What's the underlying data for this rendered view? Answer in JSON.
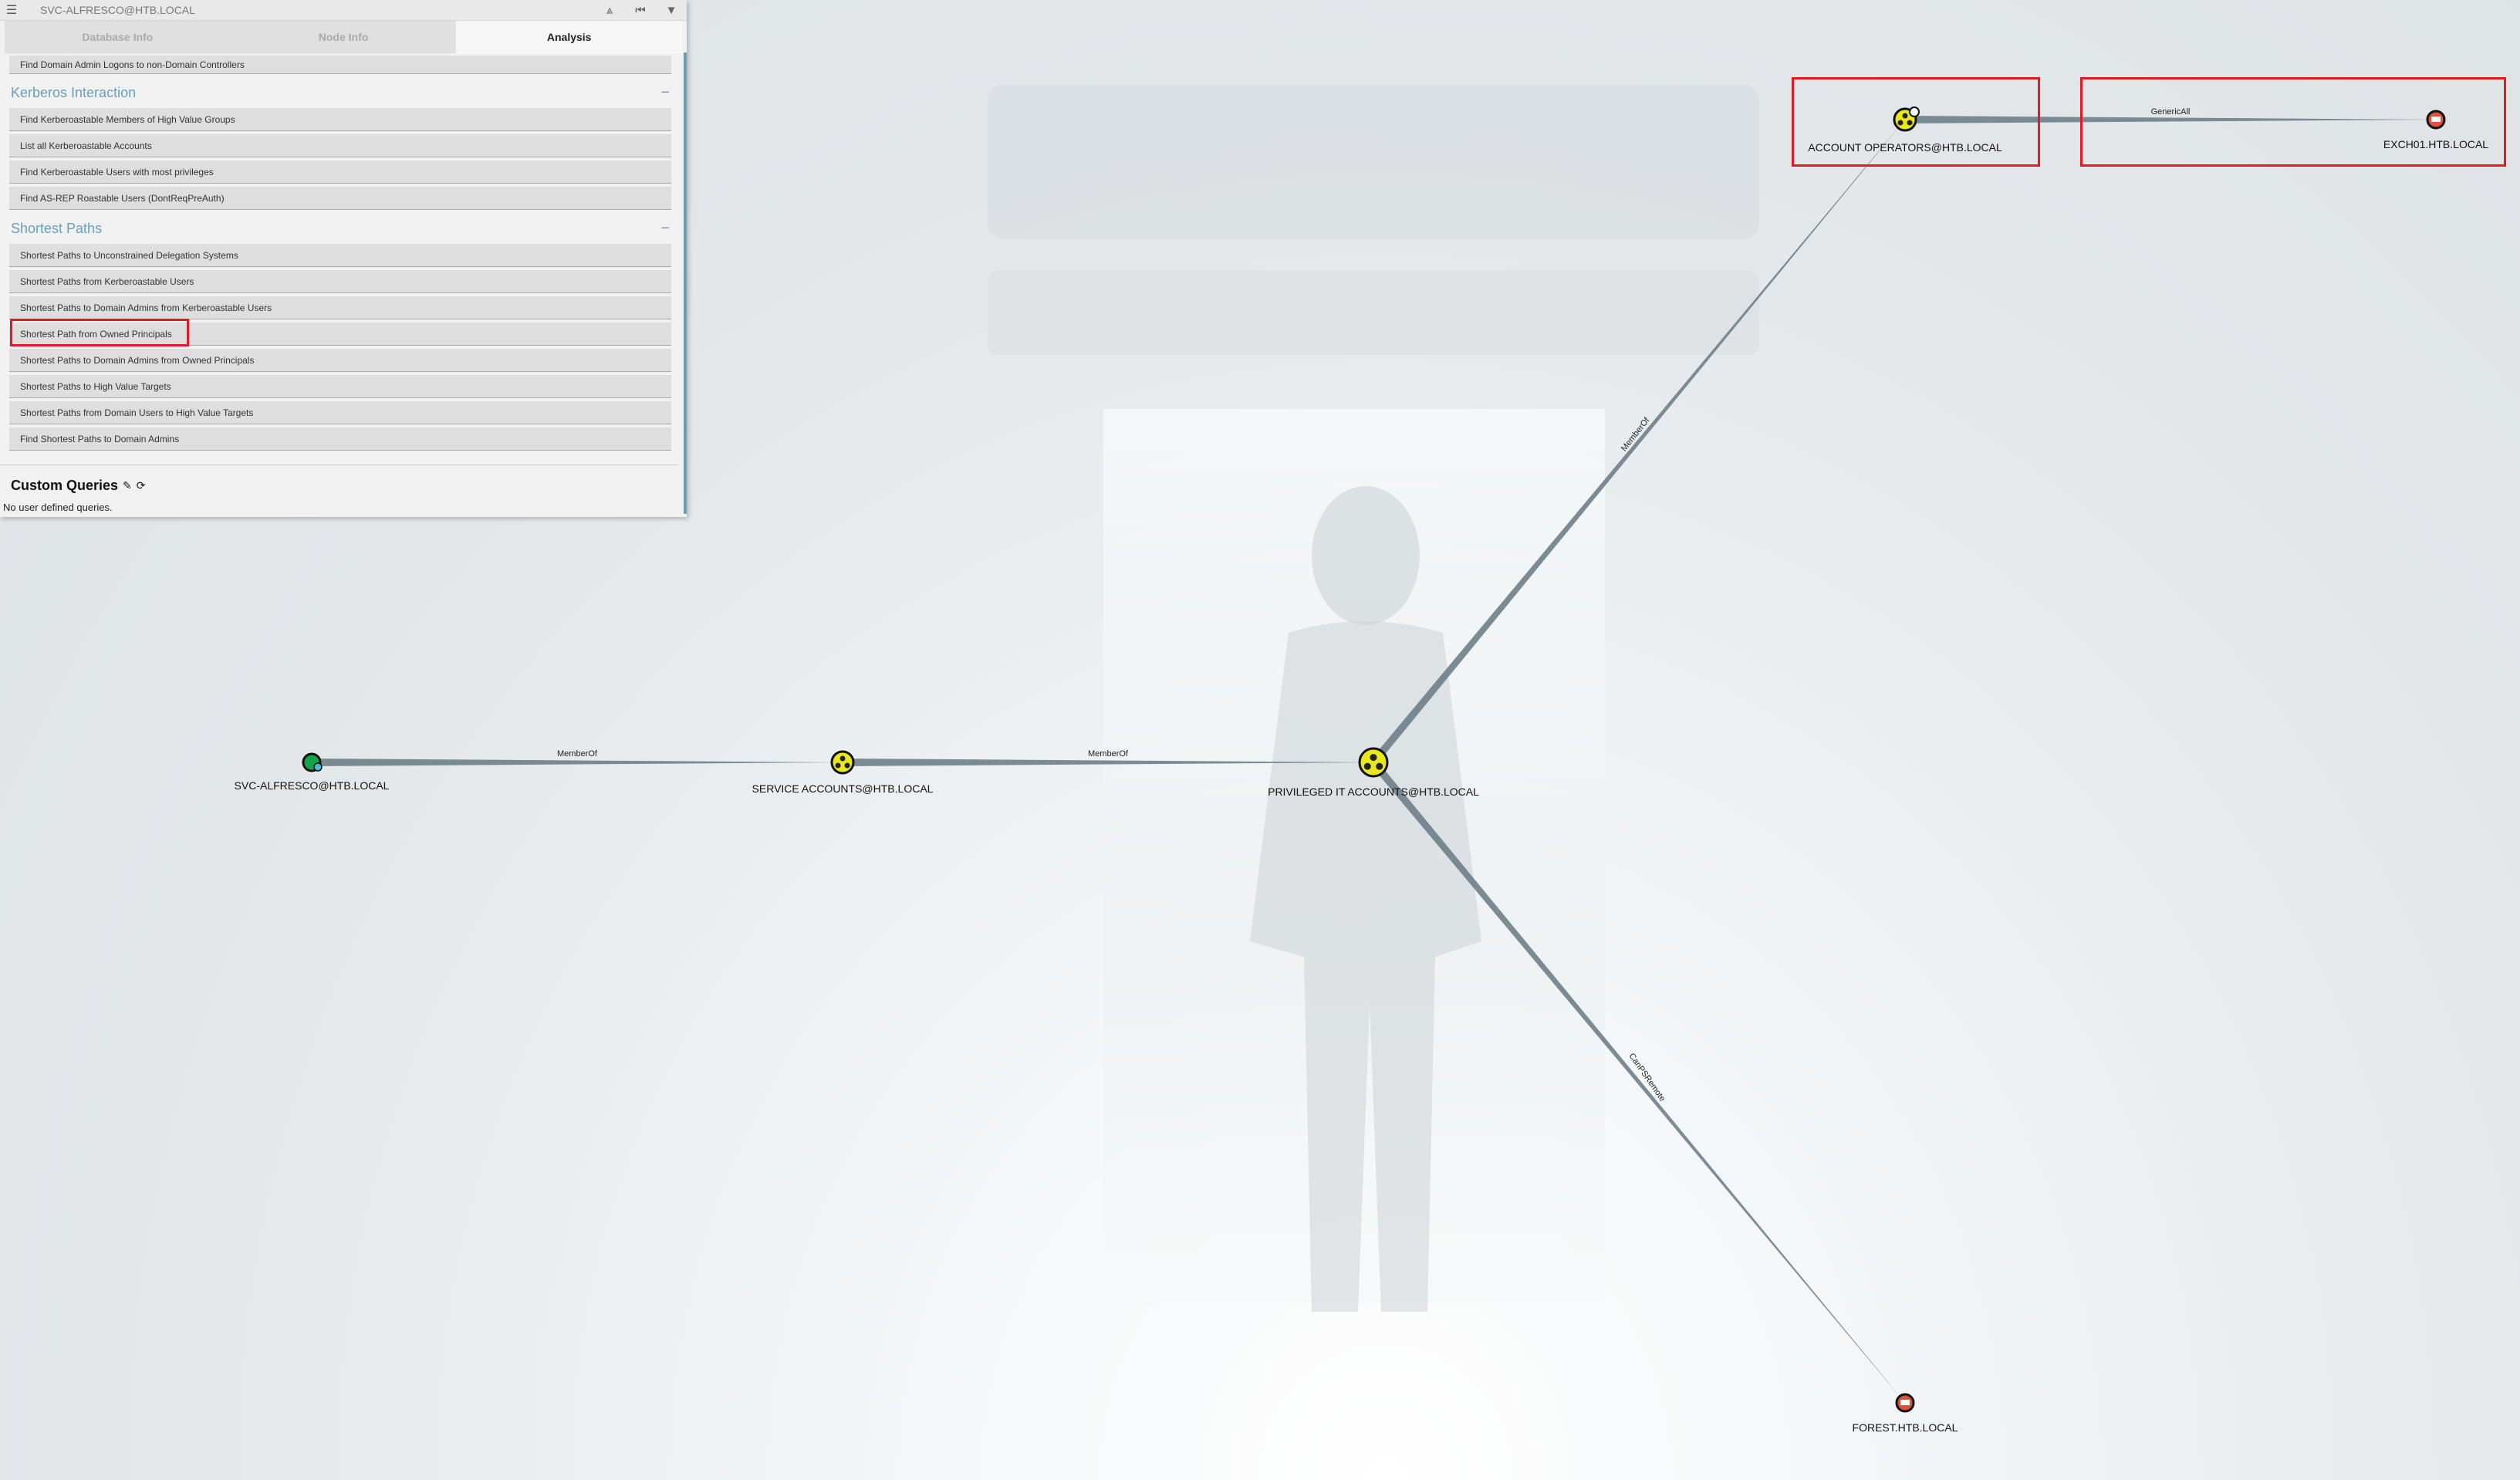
{
  "topbar": {
    "search_value": "SVC-ALFRESCO@HTB.LOCAL",
    "icons": [
      "menu-icon",
      "pathfinding-icon",
      "back-icon",
      "filter-icon"
    ]
  },
  "tabs": [
    {
      "label": "Database Info",
      "active": false
    },
    {
      "label": "Node Info",
      "active": false
    },
    {
      "label": "Analysis",
      "active": true
    }
  ],
  "analysis": {
    "first_query": "Find Domain Admin Logons to non-Domain Controllers",
    "sections": [
      {
        "title": "Kerberos Interaction",
        "items": [
          "Find Kerberoastable Members of High Value Groups",
          "List all Kerberoastable Accounts",
          "Find Kerberoastable Users with most privileges",
          "Find AS-REP Roastable Users (DontReqPreAuth)"
        ]
      },
      {
        "title": "Shortest Paths",
        "items": [
          "Shortest Paths to Unconstrained Delegation Systems",
          "Shortest Paths from Kerberoastable Users",
          "Shortest Paths to Domain Admins from Kerberoastable Users",
          "Shortest Path from Owned Principals",
          "Shortest Paths to Domain Admins from Owned Principals",
          "Shortest Paths to High Value Targets",
          "Shortest Paths from Domain Users to High Value Targets",
          "Find Shortest Paths to Domain Admins"
        ]
      }
    ],
    "highlighted_item": "Shortest Path from Owned Principals",
    "custom_queries_title": "Custom Queries",
    "custom_queries_empty": "No user defined queries."
  },
  "graph": {
    "nodes": [
      {
        "id": "svc",
        "label": "SVC-ALFRESCO@HTB.LOCAL",
        "type": "user",
        "owned": true
      },
      {
        "id": "sa",
        "label": "SERVICE ACCOUNTS@HTB.LOCAL",
        "type": "group"
      },
      {
        "id": "pit",
        "label": "PRIVILEGED IT ACCOUNTS@HTB.LOCAL",
        "type": "group"
      },
      {
        "id": "ao",
        "label": "ACCOUNT OPERATORS@HTB.LOCAL",
        "type": "group",
        "highvalue": true
      },
      {
        "id": "exch",
        "label": "EXCH01.HTB.LOCAL",
        "type": "computer"
      },
      {
        "id": "forest",
        "label": "FOREST.HTB.LOCAL",
        "type": "computer"
      }
    ],
    "edges": [
      {
        "from": "svc",
        "to": "sa",
        "label": "MemberOf"
      },
      {
        "from": "sa",
        "to": "pit",
        "label": "MemberOf"
      },
      {
        "from": "pit",
        "to": "ao",
        "label": "MemberOf"
      },
      {
        "from": "ao",
        "to": "exch",
        "label": "GenericAll"
      },
      {
        "from": "pit",
        "to": "forest",
        "label": "CanPSRemote"
      }
    ]
  },
  "colors": {
    "accent": "#6a9fb5",
    "highlight": "#e01b24",
    "group": "#e8e81a",
    "computer": "#e0503a",
    "user": "#17a34a",
    "edge": "#6d7f89"
  }
}
